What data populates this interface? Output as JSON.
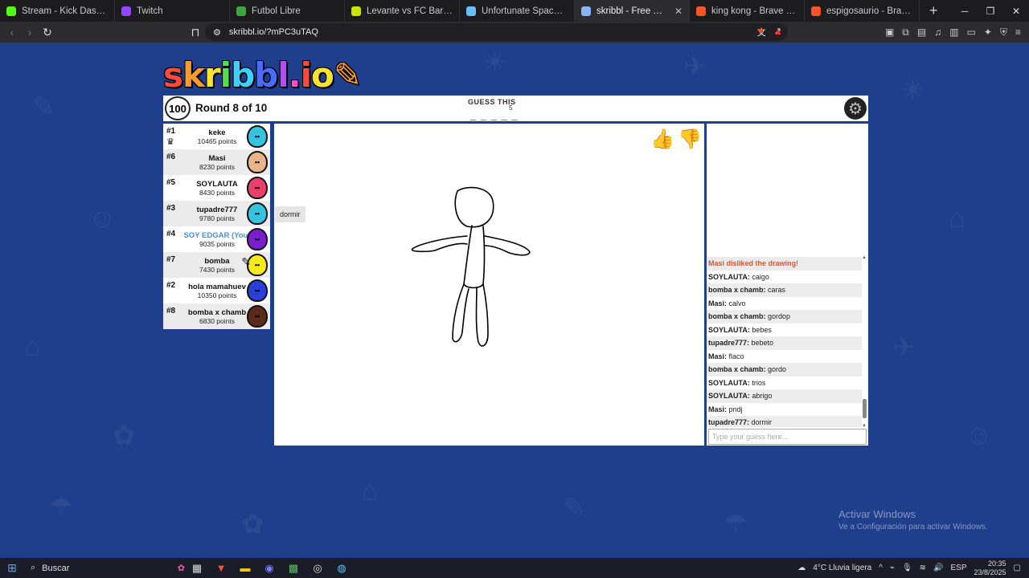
{
  "browser": {
    "tabs": [
      {
        "title": "Stream - Kick Dashboard",
        "icon": "kick-icon",
        "color": "#53fc18",
        "active": false
      },
      {
        "title": "Twitch",
        "icon": "twitch-icon",
        "color": "#9146ff",
        "active": false
      },
      {
        "title": "Futbol Libre",
        "icon": "futbol-icon",
        "color": "#3fa33f",
        "active": false
      },
      {
        "title": "Levante vs FC Barcelona + \"res",
        "icon": "livescore-icon",
        "color": "#c8e400",
        "active": false
      },
      {
        "title": "Unfortunate Spacemen en Stea",
        "icon": "steam-icon",
        "color": "#66c0f4",
        "active": false
      },
      {
        "title": "skribbl - Free Multiplayer D",
        "icon": "skribbl-icon",
        "color": "#8ab4f8",
        "active": true
      },
      {
        "title": "king kong - Brave Search",
        "icon": "brave-search-icon",
        "color": "#fb542b",
        "active": false
      },
      {
        "title": "espigosaurio - Brave Search",
        "icon": "brave-search-icon",
        "color": "#fb542b",
        "active": false
      }
    ],
    "url": "skribbl.io/?mPC3uTAQ"
  },
  "game": {
    "logo": "skribbl.io",
    "timer": "100",
    "round": "Round 8 of 10",
    "guess_label": "GUESS THIS",
    "word_length": "5",
    "hint": "_ _ _ _ _",
    "colors": {
      "page_bg": "#1f3f8c",
      "you": "#4a90d9",
      "system_msg": "#d4582d"
    },
    "players": [
      {
        "rank": "#1",
        "name": "keke",
        "points": "10465 points",
        "avatar_color": "#35c3e0",
        "you": false,
        "owner": true
      },
      {
        "rank": "#6",
        "name": "Masi",
        "points": "8230 points",
        "avatar_color": "#e8b48a",
        "you": false,
        "owner": false
      },
      {
        "rank": "#5",
        "name": "SOYLAUTA",
        "points": "8430 points",
        "avatar_color": "#e8406a",
        "you": false,
        "owner": false
      },
      {
        "rank": "#3",
        "name": "tupadre777",
        "points": "9780 points",
        "avatar_color": "#35c3e0",
        "you": false,
        "owner": false
      },
      {
        "rank": "#4",
        "name": "SOY EDGAR (You)",
        "points": "9035 points",
        "avatar_color": "#7a1fcf",
        "you": true,
        "owner": false
      },
      {
        "rank": "#7",
        "name": "bomba",
        "points": "7430 points",
        "avatar_color": "#f5e81c",
        "you": false,
        "owner": false,
        "drawing": true
      },
      {
        "rank": "#2",
        "name": "hola mamahuev",
        "points": "10350 points",
        "avatar_color": "#2a3fd6",
        "you": false,
        "owner": false
      },
      {
        "rank": "#8",
        "name": "bomba x chamb",
        "points": "6830 points",
        "avatar_color": "#5a2a1a",
        "you": false,
        "owner": false
      }
    ],
    "speech_bubble": "dormir",
    "chat": {
      "messages": [
        {
          "system": true,
          "text": "Masi disliked the drawing!"
        },
        {
          "who": "SOYLAUTA",
          "text": "caigo"
        },
        {
          "who": "bomba x chamb",
          "text": "caras"
        },
        {
          "who": "Masi",
          "text": "calvo"
        },
        {
          "who": "bomba x chamb",
          "text": "gordop"
        },
        {
          "who": "SOYLAUTA",
          "text": "bebes"
        },
        {
          "who": "tupadre777",
          "text": "bebeto"
        },
        {
          "who": "Masi",
          "text": "flaco"
        },
        {
          "who": "bomba x chamb",
          "text": "gordo"
        },
        {
          "who": "SOYLAUTA",
          "text": "trios"
        },
        {
          "who": "SOYLAUTA",
          "text": "abrigo"
        },
        {
          "who": "Masi",
          "text": "pndj"
        },
        {
          "who": "tupadre777",
          "text": "dormir"
        }
      ],
      "input_placeholder": "Type your guess here..."
    }
  },
  "watermark": {
    "title": "Activar Windows",
    "subtitle": "Ve a Configuración para activar Windows."
  },
  "taskbar": {
    "search": "Buscar",
    "weather": "4°C  Lluvia ligera",
    "lang": "ESP",
    "time": "20:35",
    "date": "23/8/2025"
  }
}
